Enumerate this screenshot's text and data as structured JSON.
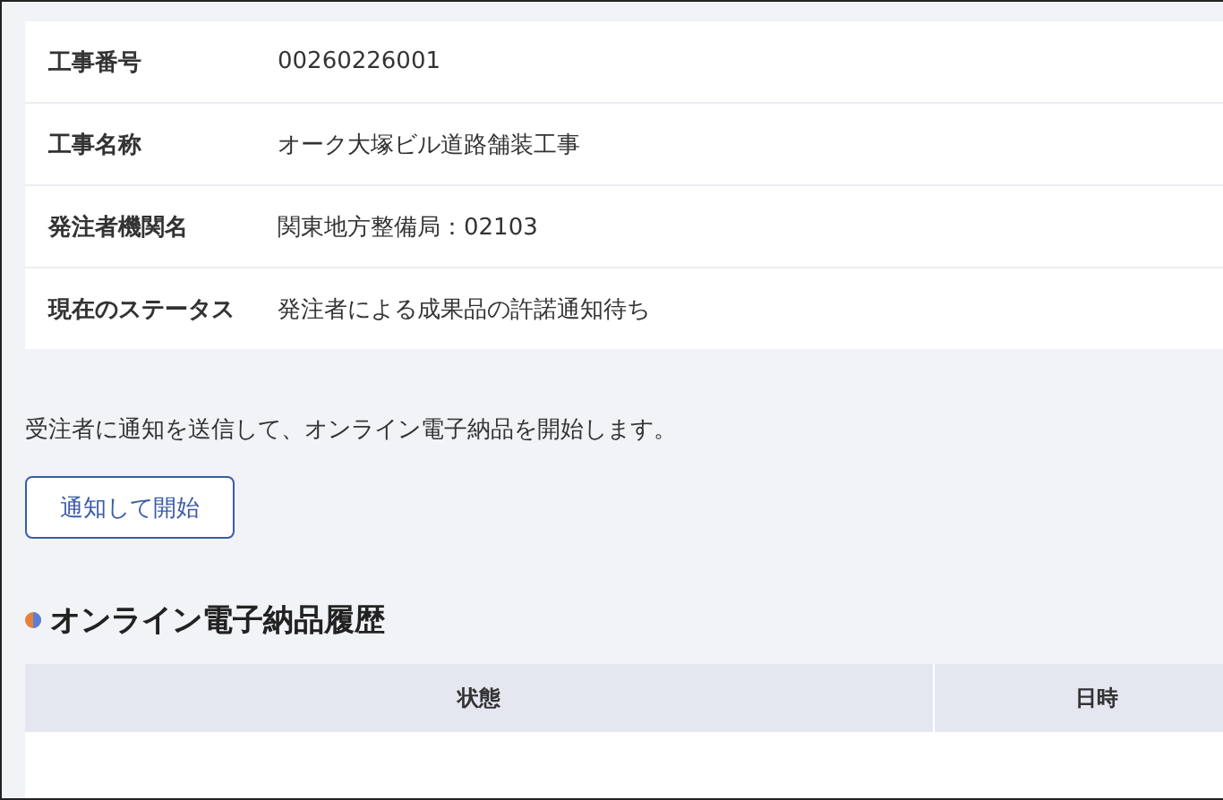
{
  "details": [
    {
      "label": "工事番号",
      "value": "00260226001"
    },
    {
      "label": "工事名称",
      "value": "オーク大塚ビル道路舗装工事"
    },
    {
      "label": "発注者機関名",
      "value": "関東地方整備局：02103"
    },
    {
      "label": "現在のステータス",
      "value": "発注者による成果品の許諾通知待ち"
    }
  ],
  "description": "受注者に通知を送信して、オンライン電子納品を開始します。",
  "start_button": "通知して開始",
  "history": {
    "title": "オンライン電子納品履歴",
    "columns": [
      "状態",
      "日時"
    ]
  }
}
